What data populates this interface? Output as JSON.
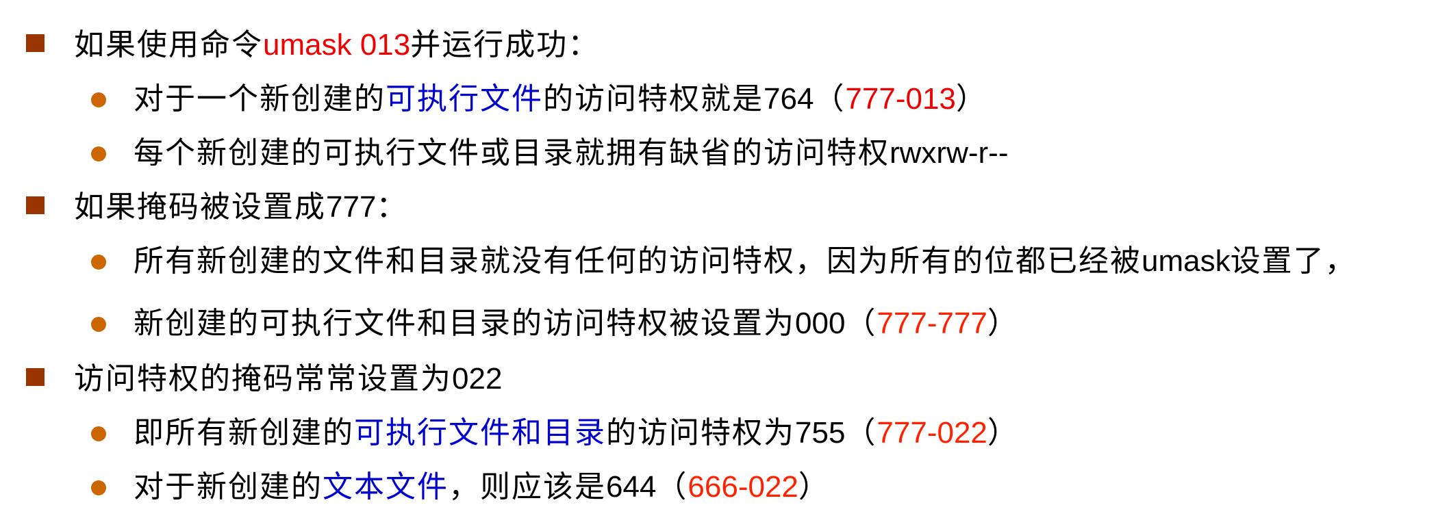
{
  "colors": {
    "text": "#000000",
    "red": "#ee0000",
    "orange_red": "#ff2200",
    "blue": "#0000cc",
    "square_bullet": "#993300",
    "dot_bullet": "#cc6600"
  },
  "items": [
    {
      "level": 1,
      "segments": [
        {
          "text": "如果使用命令",
          "color": "#000000"
        },
        {
          "text": "umask 013",
          "color": "#ee0000",
          "latin": true
        },
        {
          "text": "并运行成功：",
          "color": "#000000"
        }
      ]
    },
    {
      "level": 2,
      "segments": [
        {
          "text": "对于一个新创建的",
          "color": "#000000"
        },
        {
          "text": "可执行文件",
          "color": "#0000cc"
        },
        {
          "text": "的访问特权就是",
          "color": "#000000"
        },
        {
          "text": "764",
          "color": "#000000",
          "latin": true
        },
        {
          "text": "（",
          "color": "#000000"
        },
        {
          "text": "777-013",
          "color": "#ee0000",
          "latin": true
        },
        {
          "text": "）",
          "color": "#000000"
        }
      ]
    },
    {
      "level": 2,
      "segments": [
        {
          "text": "每个新创建的可执行文件或目录就拥有缺省的访问特权",
          "color": "#000000"
        },
        {
          "text": "rwxrw-r--",
          "color": "#000000",
          "latin": true
        }
      ]
    },
    {
      "level": 1,
      "segments": [
        {
          "text": "如果掩码被设置成",
          "color": "#000000"
        },
        {
          "text": "777",
          "color": "#000000",
          "latin": true
        },
        {
          "text": "：",
          "color": "#000000"
        }
      ]
    },
    {
      "level": 2,
      "segments": [
        {
          "text": "所有新创建的文件和目录就没有任何的访问特权，因为所有的位都已经被",
          "color": "#000000"
        },
        {
          "text": "umask",
          "color": "#000000",
          "latin": true
        },
        {
          "text": "设置了，",
          "color": "#000000"
        }
      ]
    },
    {
      "level": 2,
      "segments": [
        {
          "text": "新创建的可执行文件和目录的访问特权被设置为",
          "color": "#000000"
        },
        {
          "text": "000",
          "color": "#000000",
          "latin": true
        },
        {
          "text": "（",
          "color": "#000000"
        },
        {
          "text": "777-777",
          "color": "#ff2200",
          "latin": true
        },
        {
          "text": "）",
          "color": "#000000"
        }
      ]
    },
    {
      "level": 1,
      "segments": [
        {
          "text": "访问特权的掩码常常设置为",
          "color": "#000000"
        },
        {
          "text": "022",
          "color": "#000000",
          "latin": true
        }
      ]
    },
    {
      "level": 2,
      "segments": [
        {
          "text": "即所有新创建的",
          "color": "#000000"
        },
        {
          "text": "可执行文件和目录",
          "color": "#0000cc"
        },
        {
          "text": "的访问特权为",
          "color": "#000000"
        },
        {
          "text": "755",
          "color": "#000000",
          "latin": true
        },
        {
          "text": "（",
          "color": "#000000"
        },
        {
          "text": "777-022",
          "color": "#ff2200",
          "latin": true
        },
        {
          "text": "）",
          "color": "#000000"
        }
      ]
    },
    {
      "level": 2,
      "segments": [
        {
          "text": "对于新创建的",
          "color": "#000000"
        },
        {
          "text": "文本文件",
          "color": "#0000cc"
        },
        {
          "text": "，则应该是",
          "color": "#000000"
        },
        {
          "text": "644",
          "color": "#000000",
          "latin": true
        },
        {
          "text": "（",
          "color": "#000000"
        },
        {
          "text": "666-022",
          "color": "#ff2200",
          "latin": true
        },
        {
          "text": "）",
          "color": "#000000"
        }
      ]
    }
  ]
}
